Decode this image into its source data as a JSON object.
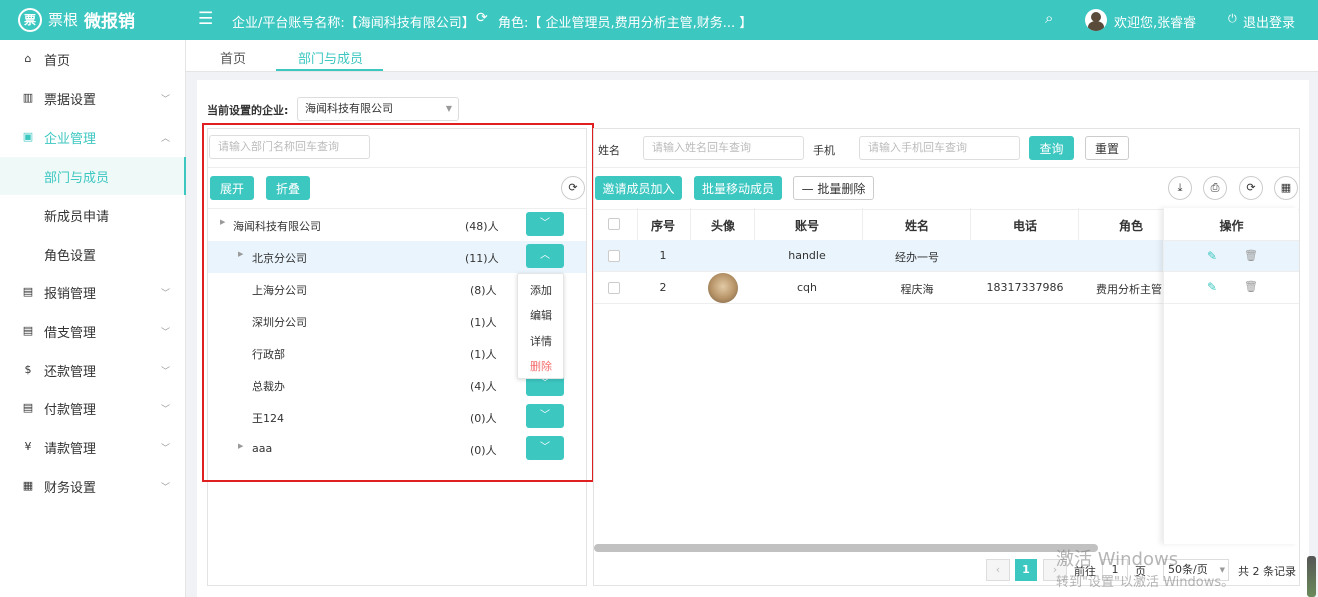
{
  "header": {
    "logo_icon": "票",
    "logo_brand": "票根",
    "logo_app": "微报销",
    "menu_icon": "☰",
    "enterprise": "企业/平台账号名称:【海闻科技有限公司】",
    "refresh_icon": "⟳",
    "role": "角色:【 企业管理员,费用分析主管,财务... 】",
    "search_icon": "⌕",
    "welcome": "欢迎您,张睿睿",
    "logout": "退出登录"
  },
  "sidebar": {
    "items": [
      {
        "label": "首页",
        "icon": "⌂"
      },
      {
        "label": "票据设置",
        "icon": "▥"
      },
      {
        "label": "企业管理",
        "icon": "▣"
      },
      {
        "label": "部门与成员"
      },
      {
        "label": "新成员申请"
      },
      {
        "label": "角色设置"
      },
      {
        "label": "报销管理",
        "icon": "▤"
      },
      {
        "label": "借支管理",
        "icon": "▤"
      },
      {
        "label": "还款管理",
        "icon": "$"
      },
      {
        "label": "付款管理",
        "icon": "▤"
      },
      {
        "label": "请款管理",
        "icon": "¥"
      },
      {
        "label": "财务设置",
        "icon": "▦"
      }
    ]
  },
  "tabs": [
    "首页",
    "部门与成员"
  ],
  "company_select": {
    "label": "当前设置的企业:",
    "value": "海闻科技有限公司"
  },
  "tree": {
    "search_placeholder": "请输入部门名称回车查询",
    "expand": "展开",
    "collapse": "折叠",
    "nodes": [
      {
        "name": "海闻科技有限公司",
        "count": "(48)人"
      },
      {
        "name": "北京分公司",
        "count": "(11)人"
      },
      {
        "name": "上海分公司",
        "count": "(8)人"
      },
      {
        "name": "深圳分公司",
        "count": "(1)人"
      },
      {
        "name": "行政部",
        "count": "(1)人"
      },
      {
        "name": "总裁办",
        "count": "(4)人"
      },
      {
        "name": "王124",
        "count": "(0)人"
      },
      {
        "name": "aaa",
        "count": "(0)人"
      }
    ],
    "menu": [
      "添加",
      "编辑",
      "详情",
      "删除"
    ]
  },
  "member_search": {
    "name_label": "姓名",
    "name_placeholder": "请输入姓名回车查询",
    "phone_label": "手机",
    "phone_placeholder": "请输入手机回车查询",
    "query": "查询",
    "reset": "重置"
  },
  "actions": {
    "invite": "邀请成员加入",
    "batch_move": "批量移动成员",
    "batch_delete": "— 批量删除"
  },
  "table": {
    "headers": [
      "序号",
      "头像",
      "账号",
      "姓名",
      "电话",
      "角色",
      "操作"
    ],
    "rows": [
      {
        "no": "1",
        "account": "handle",
        "name": "经办一号",
        "phone": "",
        "role": ""
      },
      {
        "no": "2",
        "account": "cqh",
        "name": "程庆海",
        "phone": "18317337986",
        "role": "费用分析主管"
      }
    ]
  },
  "pagination": {
    "current": "1",
    "goto_label": "前往",
    "goto_value": "1",
    "page_unit": "页",
    "page_size": "50条/页",
    "total": "共 2 条记录"
  },
  "watermark": {
    "line1": "激活 Windows",
    "line2": "转到\"设置\"以激活 Windows。"
  }
}
